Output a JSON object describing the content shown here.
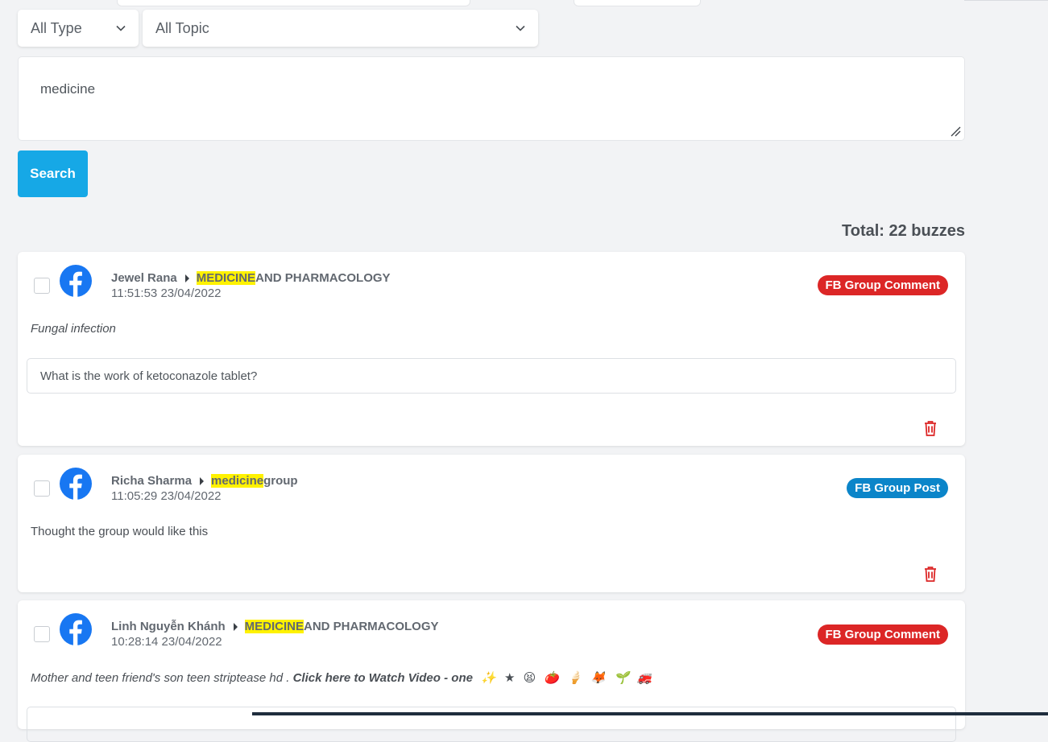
{
  "filters": {
    "type_selected": "All Type",
    "topic_selected": "All Topic"
  },
  "query": {
    "value": "medicine"
  },
  "search_button": "Search",
  "total_label": "Total: 22 buzzes",
  "posts": [
    {
      "author": "Jewel Rana",
      "group_highlight": "MEDICINE",
      "group_rest": " AND PHARMACOLOGY",
      "time": "11:51:53 23/04/2022",
      "badge": "FB Group Comment",
      "title": "Fungal infection",
      "reply": "What is the work of ketoconazole tablet?"
    },
    {
      "author": "Richa Sharma",
      "group_highlight": "medicine",
      "group_rest": " group",
      "time": "11:05:29 23/04/2022",
      "badge": "FB Group Post",
      "title": "Thought the group would like this"
    },
    {
      "author": "Linh Nguyễn Khánh",
      "group_highlight": "MEDICINE",
      "group_rest": " AND PHARMACOLOGY",
      "time": "10:28:14 23/04/2022",
      "badge": "FB Group Comment",
      "title_plain": "Mother and teen friend's son teen striptease hd . ",
      "title_bold": "Click here to Watch Video",
      "title_tail": " - one",
      "emojis": [
        "✨",
        "★",
        "😫",
        "🍅",
        "🍦",
        "🦊",
        "🌱",
        "🚒"
      ]
    }
  ],
  "colors": {
    "accent": "#16a8e6",
    "badge_comment": "#dc2626",
    "badge_post": "#0b85c9",
    "highlight": "#fff200",
    "facebook": "#1877f2",
    "trash": "#dc2626"
  }
}
